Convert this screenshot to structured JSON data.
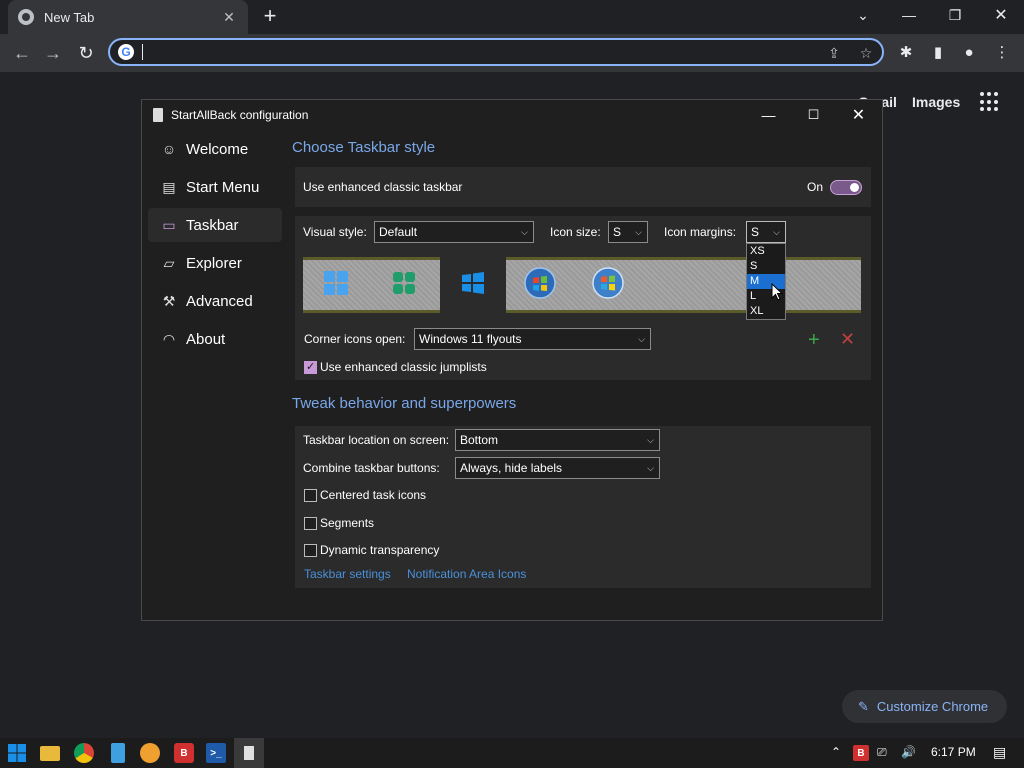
{
  "chrome": {
    "tab_title": "New Tab",
    "tab_close": "✕",
    "new_tab": "+",
    "ntp": {
      "gmail": "Gmail",
      "images": "Images",
      "customize": "Customize Chrome"
    }
  },
  "app": {
    "title": "StartAllBack configuration",
    "sidebar": [
      {
        "label": "Welcome",
        "icon": "smiley-icon"
      },
      {
        "label": "Start Menu",
        "icon": "start-menu-icon"
      },
      {
        "label": "Taskbar",
        "icon": "taskbar-icon"
      },
      {
        "label": "Explorer",
        "icon": "folder-icon"
      },
      {
        "label": "Advanced",
        "icon": "wrench-icon"
      },
      {
        "label": "About",
        "icon": "gauge-icon"
      }
    ],
    "section1": {
      "heading": "Choose Taskbar style",
      "enhanced_label": "Use enhanced classic taskbar",
      "toggle_state": "On",
      "visual_style_label": "Visual style:",
      "visual_style_value": "Default",
      "icon_size_label": "Icon size:",
      "icon_size_value": "S",
      "icon_margins_label": "Icon margins:",
      "icon_margins_value": "S",
      "icon_margins_options": [
        "XS",
        "S",
        "M",
        "L",
        "XL"
      ],
      "icon_margins_highlighted": "M",
      "corner_label": "Corner icons open:",
      "corner_value": "Windows 11 flyouts",
      "jumplists_label": "Use enhanced classic jumplists",
      "jumplists_checked": true
    },
    "section2": {
      "heading": "Tweak behavior and superpowers",
      "location_label": "Taskbar location on screen:",
      "location_value": "Bottom",
      "combine_label": "Combine taskbar buttons:",
      "combine_value": "Always, hide labels",
      "centered_label": "Centered task icons",
      "segments_label": "Segments",
      "transparency_label": "Dynamic transparency",
      "link1": "Taskbar settings",
      "link2": "Notification Area Icons"
    }
  },
  "taskbar": {
    "time": "6:17 PM"
  },
  "colors": {
    "accent": "#7aa7e8",
    "toggle": "#c8a2d8",
    "link": "#4a90d9",
    "chrome_accent": "#8ab4f8"
  }
}
